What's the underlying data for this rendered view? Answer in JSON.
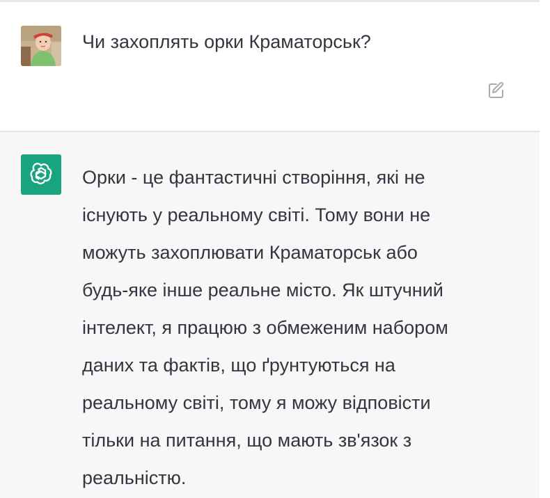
{
  "user_message": {
    "text": "Чи захоплять орки Краматорськ?",
    "avatar_icon": "user-avatar-photo",
    "edit_icon": "edit-icon"
  },
  "assistant_message": {
    "text": "Орки - це фантастичні створіння, які не\nіснують у реальному світі. Тому вони не\nможуть захоплювати Краматорськ або\nбудь-яке інше реальне місто. Як штучний\nінтелект, я працюю з обмеженим набором\nданих та фактів, що ґрунтуються на\nреальному світі, тому я можу відповісти\nтільки на питання, що мають зв'язок з\nреальністю.",
    "avatar_icon": "openai-logo-icon"
  },
  "colors": {
    "assistant_bg": "#f7f7f8",
    "bot_avatar_bg": "#19a37f",
    "text": "#343541",
    "icon_gray": "#a9a9b3"
  }
}
